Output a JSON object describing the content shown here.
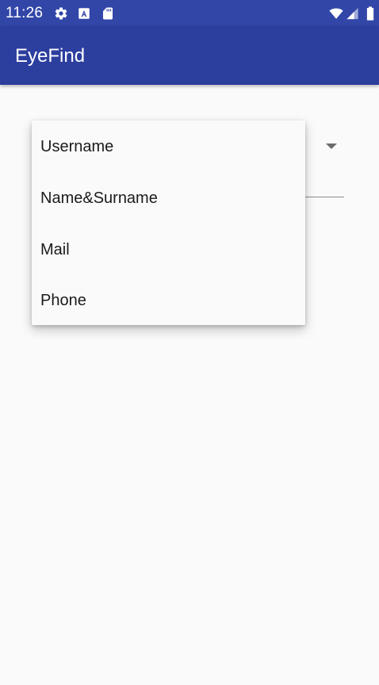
{
  "status_bar": {
    "time": "11:26",
    "icons": [
      "settings-icon",
      "a-box-icon",
      "sd-card-icon",
      "wifi-icon",
      "signal-icon",
      "battery-icon"
    ],
    "background_color": "#3246a8"
  },
  "app_bar": {
    "title": "EyeFind",
    "background_color": "#2c3e9e"
  },
  "dropdown": {
    "options": [
      "Username",
      "Name&Surname",
      "Mail",
      "Phone"
    ]
  }
}
